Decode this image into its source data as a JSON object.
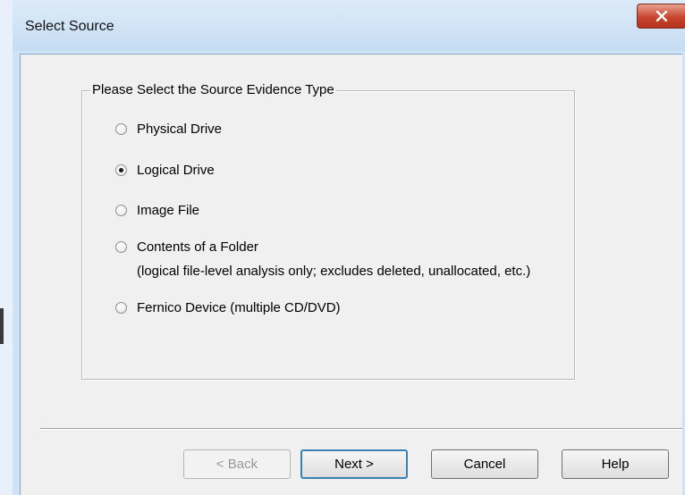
{
  "window": {
    "title": "Select Source",
    "close_symbol": "X"
  },
  "group": {
    "legend": "Please Select the Source Evidence Type",
    "options": [
      {
        "label": "Physical Drive",
        "selected": false
      },
      {
        "label": "Logical Drive",
        "selected": true
      },
      {
        "label": "Image File",
        "selected": false
      },
      {
        "label": "Contents of a Folder",
        "sublabel": "(logical file-level analysis only; excludes deleted, unallocated, etc.)",
        "selected": false
      },
      {
        "label": "Fernico Device (multiple CD/DVD)",
        "selected": false
      }
    ]
  },
  "buttons": {
    "back": "< Back",
    "next": "Next >",
    "cancel": "Cancel",
    "help": "Help"
  },
  "colors": {
    "close_button": "#c8452e",
    "dialog_background": "#f0f0f0",
    "title_bar": "#cfe3f6"
  },
  "icons": {
    "close": "close-x-icon",
    "radio_selected": "radio-selected-icon",
    "radio_unselected": "radio-unselected-icon"
  }
}
